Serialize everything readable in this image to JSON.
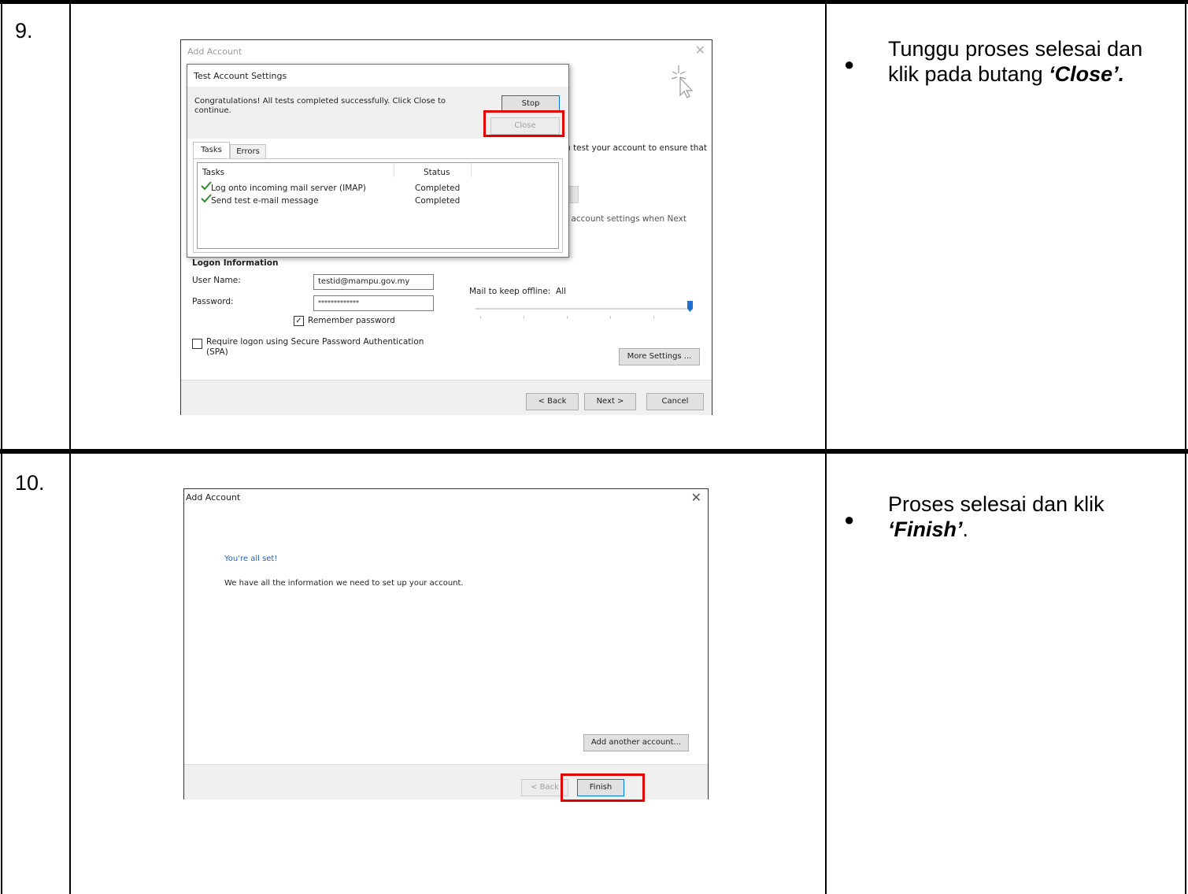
{
  "steps": [
    {
      "number": "9.",
      "instruction": {
        "text": "Tunggu proses selesai dan klik pada butang ",
        "emphasis": "‘Close’."
      },
      "dialog": {
        "window_title": "Add Account",
        "test_dialog": {
          "title": "Test Account Settings",
          "message": "Congratulations! All tests completed successfully. Click Close to continue.",
          "stop_label": "Stop",
          "close_label": "Close",
          "tabs": [
            "Tasks",
            "Errors"
          ],
          "columns": [
            "Tasks",
            "Status"
          ],
          "rows": [
            {
              "task": "Log onto incoming mail server (IMAP)",
              "status": "Completed"
            },
            {
              "task": "Send test e-mail message",
              "status": "Completed"
            }
          ]
        },
        "behind_text_1": "u test your account to ensure that",
        "behind_text_2": "t account settings when Next",
        "logon_heading": "Logon Information",
        "username_label": "User Name:",
        "username_value": "testid@mampu.gov.my",
        "password_label": "Password:",
        "password_value": "*************",
        "remember_label": "Remember password",
        "spa_label_1": "Require logon using Secure Password Authentication",
        "spa_label_2": "(SPA)",
        "offline_label": "Mail to keep offline:",
        "offline_value": "All",
        "offline_level": 1.0,
        "more_settings_label": "More Settings ...",
        "back_label": "< Back",
        "next_label": "Next >",
        "cancel_label": "Cancel"
      }
    },
    {
      "number": "10.",
      "instruction": {
        "text": "Proses selesai dan klik ",
        "emphasis": "‘Finish’",
        "suffix": "."
      },
      "dialog": {
        "window_title": "Add Account",
        "heading": "You're all set!",
        "message": "We have all the information we need to set up your account.",
        "add_another_label": "Add another account...",
        "back_label": "< Back",
        "finish_label": "Finish"
      }
    }
  ],
  "colors": {
    "highlight": "#e00000",
    "link_blue": "#1f5fb4",
    "check_green": "#2e8b2e",
    "slider_blue": "#1f6fd1"
  }
}
